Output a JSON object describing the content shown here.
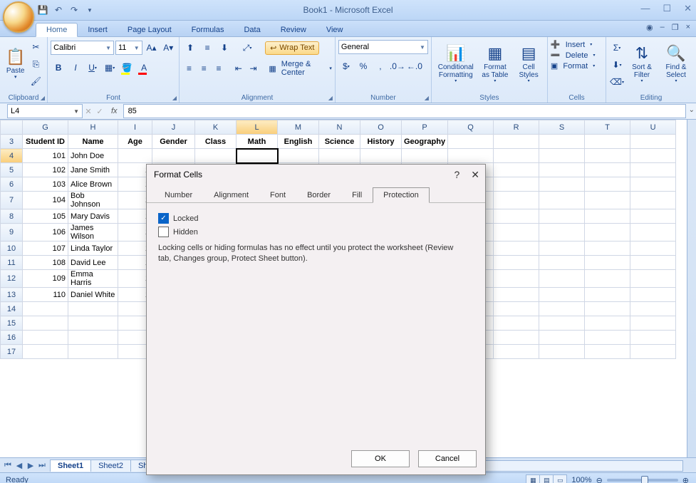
{
  "app": {
    "title": "Book1 - Microsoft Excel"
  },
  "qat": {
    "save": "💾",
    "undo": "↶",
    "redo": "↷"
  },
  "win": {
    "min": "—",
    "max": "☐",
    "close": "✕"
  },
  "tabs": {
    "home": "Home",
    "insert": "Insert",
    "page": "Page Layout",
    "formulas": "Formulas",
    "data": "Data",
    "review": "Review",
    "view": "View"
  },
  "doc_win": {
    "min": "–",
    "restore": "❐",
    "close": "×",
    "help": "◉"
  },
  "ribbon": {
    "clipboard": {
      "label": "Clipboard",
      "paste": "Paste"
    },
    "font": {
      "label": "Font",
      "name": "Calibri",
      "size": "11"
    },
    "alignment": {
      "label": "Alignment",
      "wrap": "Wrap Text",
      "merge": "Merge & Center"
    },
    "number": {
      "label": "Number",
      "format": "General"
    },
    "styles": {
      "label": "Styles",
      "cond": "Conditional Formatting",
      "table": "Format as Table",
      "cell": "Cell Styles"
    },
    "cells": {
      "label": "Cells",
      "insert": "Insert",
      "delete": "Delete",
      "format": "Format"
    },
    "editing": {
      "label": "Editing",
      "sort": "Sort & Filter",
      "find": "Find & Select"
    }
  },
  "namebox": "L4",
  "formula": "85",
  "cols": [
    "G",
    "H",
    "I",
    "J",
    "K",
    "L",
    "M",
    "N",
    "O",
    "P",
    "Q",
    "R",
    "S",
    "T",
    "U"
  ],
  "headers": {
    "g": "Student ID",
    "h": "Name",
    "i": "Age",
    "j": "Gender",
    "k": "Class",
    "l": "Math",
    "m": "English",
    "n": "Science",
    "o": "History",
    "p": "Geography"
  },
  "rows": [
    {
      "n": "4",
      "id": "101",
      "name": "John Doe",
      "age": ""
    },
    {
      "n": "5",
      "id": "102",
      "name": "Jane Smith",
      "age": "1"
    },
    {
      "n": "6",
      "id": "103",
      "name": "Alice Brown",
      "age": "1"
    },
    {
      "n": "7",
      "id": "104",
      "name": "Bob Johnson",
      "age": "1"
    },
    {
      "n": "8",
      "id": "105",
      "name": "Mary Davis",
      "age": "1"
    },
    {
      "n": "9",
      "id": "106",
      "name": "James Wilson",
      "age": "1"
    },
    {
      "n": "10",
      "id": "107",
      "name": "Linda Taylor",
      "age": "1"
    },
    {
      "n": "11",
      "id": "108",
      "name": "David Lee",
      "age": "1"
    },
    {
      "n": "12",
      "id": "109",
      "name": "Emma Harris",
      "age": "1"
    },
    {
      "n": "13",
      "id": "110",
      "name": "Daniel White",
      "age": "1"
    }
  ],
  "empty_rows": [
    "14",
    "15",
    "16",
    "17"
  ],
  "sheets": {
    "s1": "Sheet1",
    "s2": "Sheet2",
    "s3": "Shee"
  },
  "status": {
    "ready": "Ready",
    "zoom": "100%"
  },
  "dialog": {
    "title": "Format Cells",
    "tabs": {
      "number": "Number",
      "alignment": "Alignment",
      "font": "Font",
      "border": "Border",
      "fill": "Fill",
      "protection": "Protection"
    },
    "locked": "Locked",
    "hidden": "Hidden",
    "note": "Locking cells or hiding formulas has no effect until you protect the worksheet (Review tab, Changes group, Protect Sheet button).",
    "ok": "OK",
    "cancel": "Cancel"
  }
}
